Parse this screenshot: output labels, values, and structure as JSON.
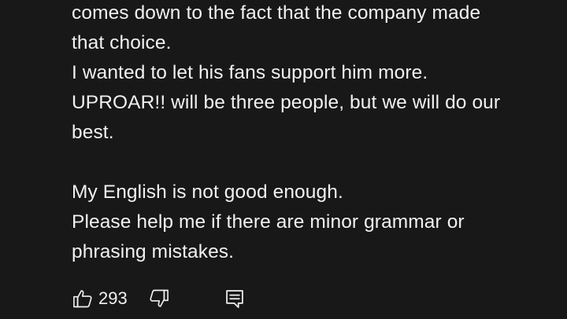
{
  "comment": {
    "lines": [
      "comes down to the fact that the company made",
      "that choice.",
      "I wanted to let his fans support him more.",
      "UPROAR!! will be three people, but we will do our",
      "best.",
      "",
      "My English is not good enough.",
      "Please help me if there are minor grammar or",
      "phrasing mistakes."
    ]
  },
  "actions": {
    "like_count": "293",
    "like_icon": "thumbs-up-icon",
    "dislike_icon": "thumbs-down-icon",
    "reply_icon": "reply-comment-icon"
  },
  "colors": {
    "background": "#181818",
    "text": "#f1f1f1"
  }
}
